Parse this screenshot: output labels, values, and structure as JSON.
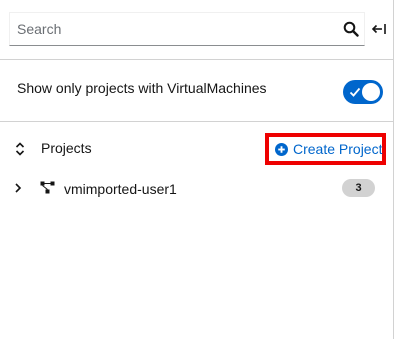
{
  "search": {
    "placeholder": "Search",
    "icon": "search-icon",
    "collapse_icon": "collapse-panel-icon"
  },
  "filter": {
    "label": "Show only projects with VirtualMachines",
    "toggle_on": true,
    "toggle_color": "#0066cc"
  },
  "projects": {
    "header_label": "Projects",
    "sort_icon": "sort-icon",
    "create_label": "Create Project",
    "create_icon": "plus-circle-icon",
    "highlight_color": "#ee0000",
    "items": [
      {
        "name": "vmimported-user1",
        "count": "3",
        "icon": "project-tree-icon"
      }
    ]
  },
  "colors": {
    "link": "#0066cc",
    "badge": "#d2d2d2"
  }
}
